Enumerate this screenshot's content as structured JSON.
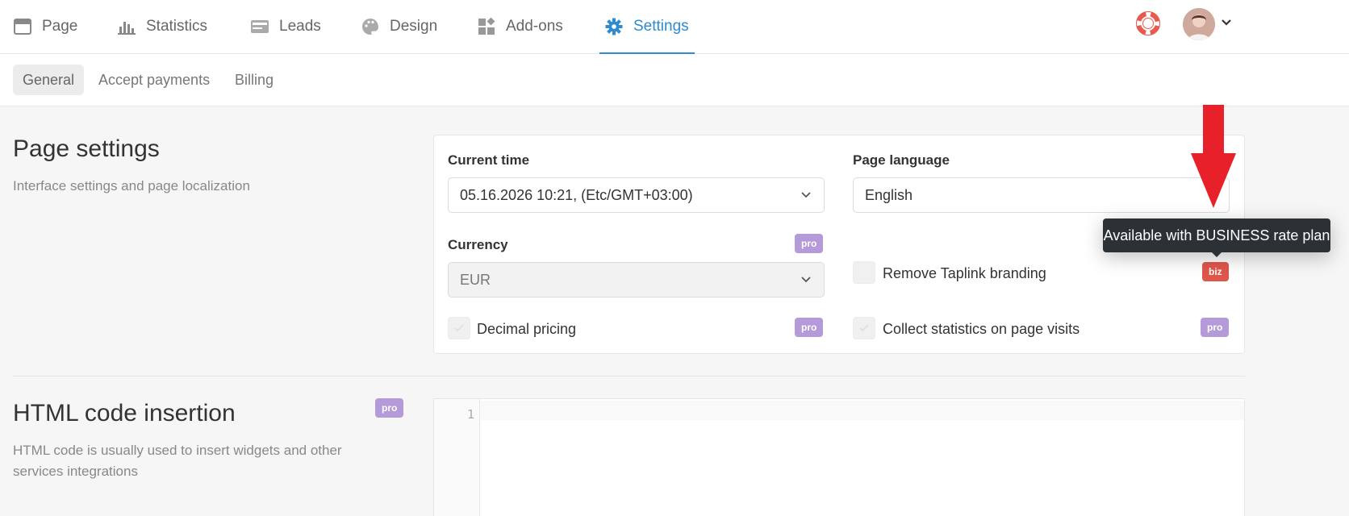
{
  "topnav": {
    "items": [
      {
        "label": "Page",
        "icon": "page-icon"
      },
      {
        "label": "Statistics",
        "icon": "chart-icon"
      },
      {
        "label": "Leads",
        "icon": "leads-icon"
      },
      {
        "label": "Design",
        "icon": "palette-icon"
      },
      {
        "label": "Add-ons",
        "icon": "addons-icon"
      },
      {
        "label": "Settings",
        "icon": "gear-icon",
        "active": true
      }
    ],
    "accent": "#2e8bd0"
  },
  "subnav": {
    "tabs": [
      {
        "label": "General",
        "active": true
      },
      {
        "label": "Accept payments"
      },
      {
        "label": "Billing"
      }
    ]
  },
  "page_settings": {
    "title": "Page settings",
    "description": "Interface settings and page localization",
    "current_time": {
      "label": "Current time",
      "value": "05.16.2026 10:21, (Etc/GMT+03:00)"
    },
    "page_language": {
      "label": "Page language",
      "value": "English"
    },
    "currency": {
      "label": "Currency",
      "value": "EUR",
      "badge": "pro"
    },
    "remove_branding": {
      "label": "Remove Taplink branding",
      "badge": "biz"
    },
    "decimal_pricing": {
      "label": "Decimal pricing",
      "badge": "pro"
    },
    "collect_stats": {
      "label": "Collect statistics on page visits",
      "badge": "pro"
    }
  },
  "html_insertion": {
    "title": "HTML code insertion",
    "description": "HTML code is usually used to insert widgets and other services integrations",
    "badge": "pro",
    "line_number": "1"
  },
  "tooltip": {
    "text": "Available with BUSINESS rate plan"
  },
  "colors": {
    "pro": "#b49ad8",
    "biz": "#e0564a",
    "arrow": "#e8202a"
  }
}
